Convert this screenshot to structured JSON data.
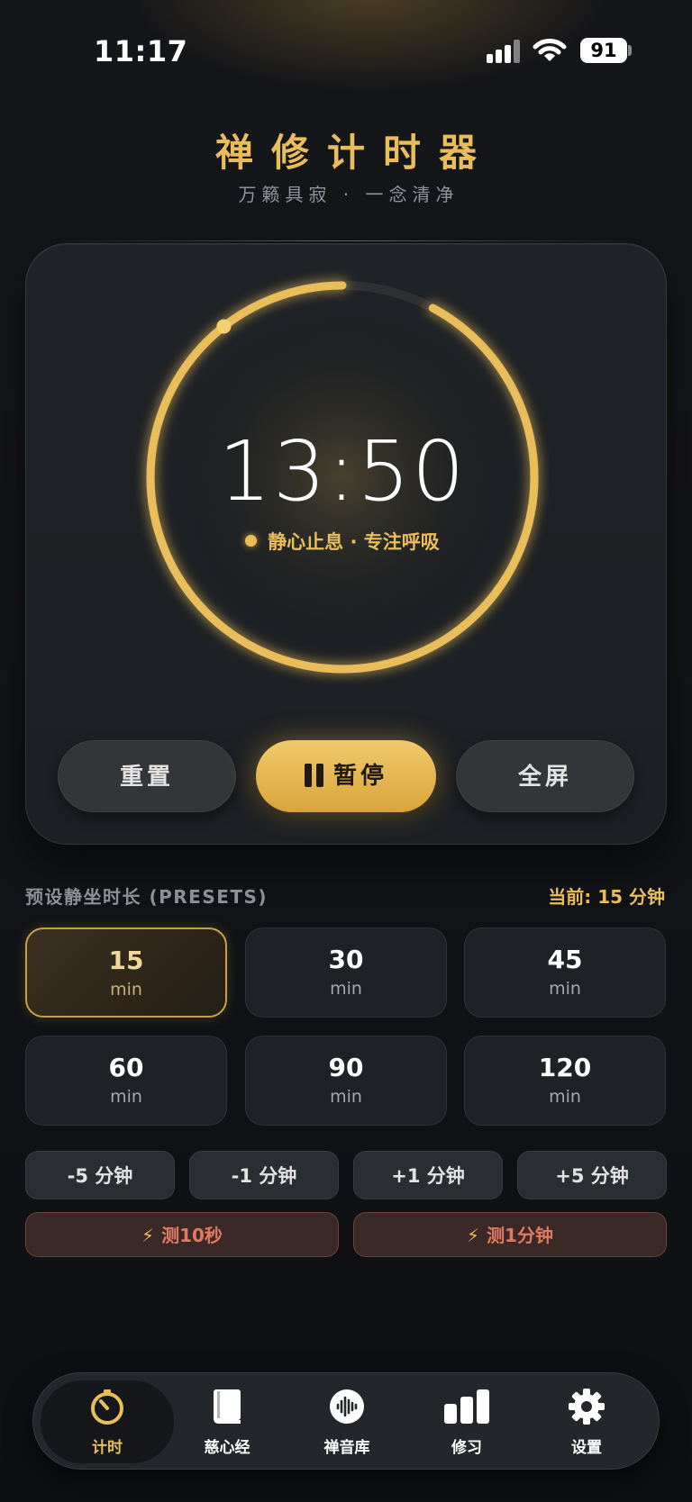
{
  "status_bar": {
    "time": "11:17",
    "battery": "91"
  },
  "header": {
    "title": "禅修计时器",
    "subtitle": "万籁具寂 · 一念清净"
  },
  "timer": {
    "time": "13:50",
    "state_text": "静心止息 · 专注呼吸",
    "progress_remaining": 0.922,
    "accent": "#e8bd5a"
  },
  "controls": {
    "reset": "重置",
    "pause": "暂停",
    "fullscreen": "全屏"
  },
  "presets": {
    "label": "预设静坐时长 (PRESETS)",
    "current": "当前: 15 分钟",
    "items": [
      {
        "value": "15",
        "unit": "min"
      },
      {
        "value": "30",
        "unit": "min"
      },
      {
        "value": "45",
        "unit": "min"
      },
      {
        "value": "60",
        "unit": "min"
      },
      {
        "value": "90",
        "unit": "min"
      },
      {
        "value": "120",
        "unit": "min"
      }
    ]
  },
  "adjust": [
    "-5 分钟",
    "-1 分钟",
    "+1 分钟",
    "+5 分钟"
  ],
  "tests": [
    "测10秒",
    "测1分钟"
  ],
  "tabs": [
    {
      "label": "计时",
      "icon": "timer-icon"
    },
    {
      "label": "慈心经",
      "icon": "book-icon"
    },
    {
      "label": "禅音库",
      "icon": "sound-wave-icon"
    },
    {
      "label": "修习",
      "icon": "bar-chart-icon"
    },
    {
      "label": "设置",
      "icon": "gear-icon"
    }
  ]
}
